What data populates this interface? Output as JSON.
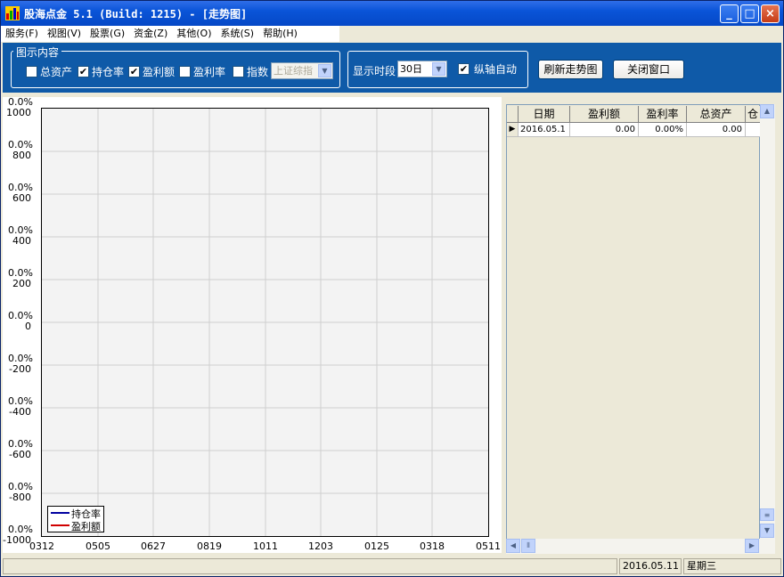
{
  "window": {
    "title": "股海点金  5.1  (Build: 1215) - [走势图]"
  },
  "menu": [
    "服务(F)",
    "视图(V)",
    "股票(G)",
    "资金(Z)",
    "其他(O)",
    "系统(S)",
    "帮助(H)"
  ],
  "toolbar": {
    "group_label": "图示内容",
    "checks": [
      {
        "label": "总资产",
        "checked": false
      },
      {
        "label": "持仓率",
        "checked": true
      },
      {
        "label": "盈利额",
        "checked": true
      },
      {
        "label": "盈利率",
        "checked": false
      },
      {
        "label": "指数",
        "checked": false
      }
    ],
    "index_select": "上证综指",
    "period_label": "显示时段",
    "period_value": "30日",
    "axis_auto_label": "纵轴自动",
    "axis_auto_checked": true,
    "refresh_button": "刷新走势图",
    "close_button": "关闭窗口"
  },
  "chart_data": {
    "type": "line",
    "y_left_pct": [
      "0.0%",
      "0.0%",
      "0.0%",
      "0.0%",
      "0.0%",
      "0.0%",
      "0.0%",
      "0.0%",
      "0.0%",
      "0.0%",
      "0.0%"
    ],
    "y_values": [
      "1000",
      "800",
      "600",
      "400",
      "200",
      "0",
      "-200",
      "-400",
      "-600",
      "-800",
      "-1000"
    ],
    "ylim": [
      -1000,
      1000
    ],
    "x_ticks": [
      "0312",
      "0505",
      "0627",
      "0819",
      "1011",
      "1203",
      "0125",
      "0318",
      "0511"
    ],
    "grid": true,
    "legend_position": "bottom-left",
    "series": [
      {
        "name": "持仓率",
        "color": "#0000a0",
        "values": []
      },
      {
        "name": "盈利额",
        "color": "#d00000",
        "values": []
      }
    ]
  },
  "table": {
    "headers": [
      "日期",
      "盈利额",
      "盈利率",
      "总资产",
      "仓"
    ],
    "rows": [
      [
        "2016.05.1",
        "0.00",
        "0.00%",
        "0.00",
        ""
      ]
    ]
  },
  "status": {
    "date": "2016.05.11",
    "weekday": "星期三"
  }
}
